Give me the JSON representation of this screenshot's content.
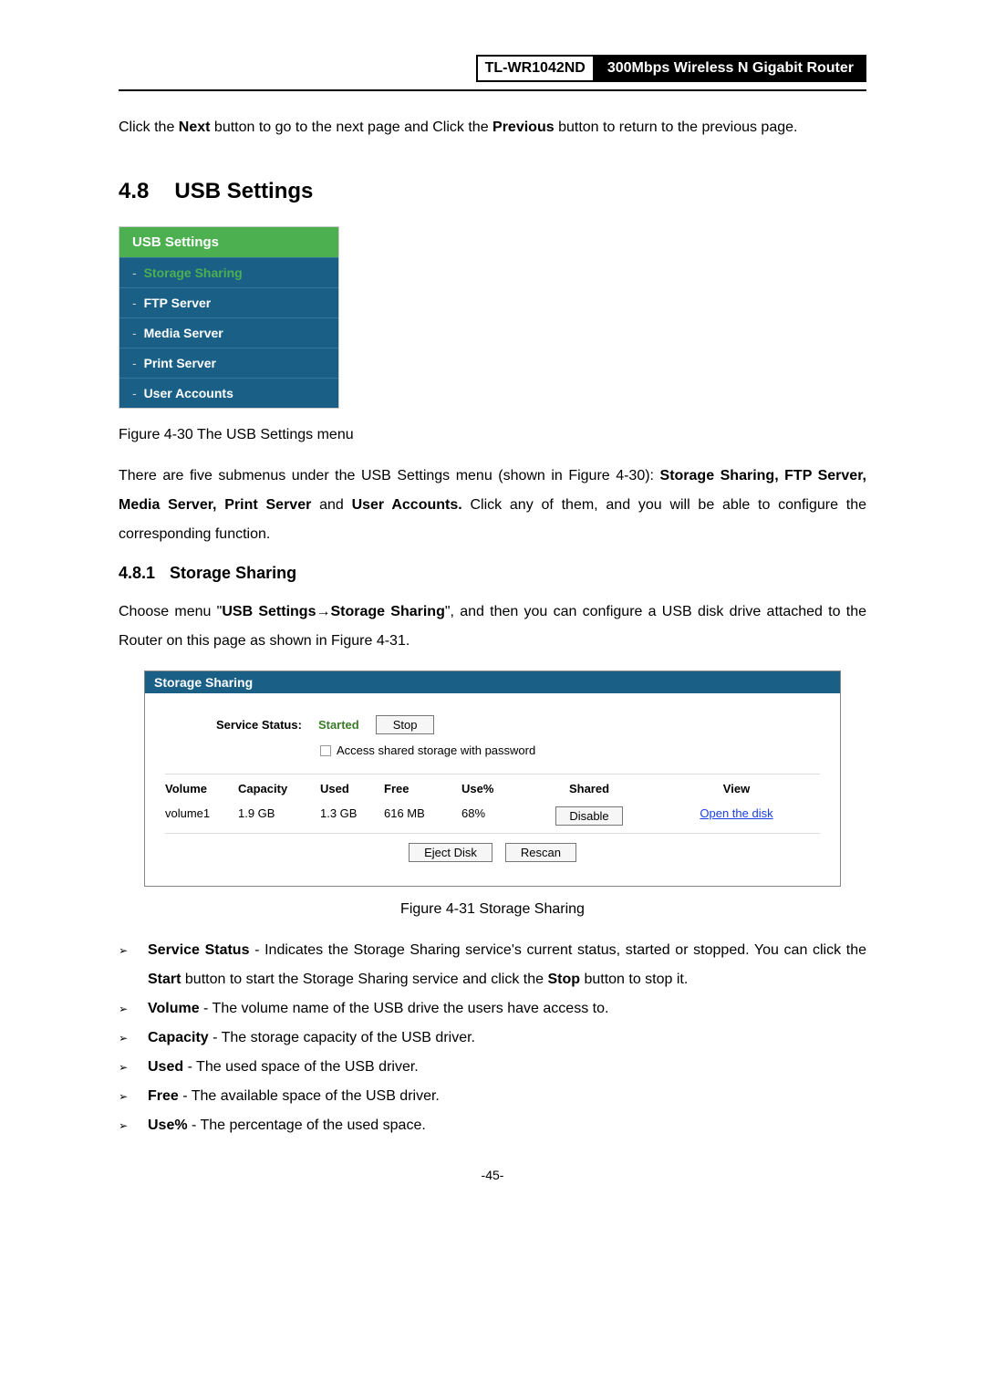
{
  "header": {
    "model": "TL-WR1042ND",
    "product": "300Mbps Wireless N Gigabit Router"
  },
  "intro": {
    "pre": "Click the ",
    "b1": "Next",
    "mid": " button to go to the next page and Click the ",
    "b2": "Previous",
    "post": " button to return to the previous page."
  },
  "section": {
    "num": "4.8",
    "title": "USB Settings"
  },
  "menu": {
    "header": "USB Settings",
    "items": [
      {
        "label": "Storage Sharing",
        "active": true
      },
      {
        "label": "FTP Server",
        "active": false
      },
      {
        "label": "Media Server",
        "active": false
      },
      {
        "label": "Print Server",
        "active": false
      },
      {
        "label": "User Accounts",
        "active": false
      }
    ]
  },
  "fig430": "Figure 4-30 The USB Settings menu",
  "para1": {
    "pre": "There are five submenus under the USB Settings menu (shown in Figure 4-30): ",
    "bold": "Storage Sharing, FTP Server, Media Server, Print Server",
    "mid": " and ",
    "bold2": "User Accounts.",
    "post": " Click any of them, and you will be able to configure the corresponding function."
  },
  "subsection": {
    "num": "4.8.1",
    "title": "Storage Sharing"
  },
  "para2": {
    "pre": "Choose menu \"",
    "b1": "USB Settings",
    "arrow": "→",
    "b2": "Storage Sharing",
    "post": "\", and then you can configure a USB disk drive attached to the Router on this page as shown in Figure 4-31."
  },
  "panel": {
    "title": "Storage Sharing",
    "service_status_label": "Service Status:",
    "service_status_val": "Started",
    "stop_btn": "Stop",
    "checkbox_label": "Access shared storage with password",
    "headers": {
      "vol": "Volume",
      "cap": "Capacity",
      "used": "Used",
      "free": "Free",
      "usep": "Use%",
      "shared": "Shared",
      "view": "View"
    },
    "row": {
      "vol": "volume1",
      "cap": "1.9 GB",
      "used": "1.3 GB",
      "free": "616 MB",
      "usep": "68%",
      "shared_btn": "Disable",
      "view_link": "Open the disk"
    },
    "eject": "Eject Disk",
    "rescan": "Rescan"
  },
  "fig431": "Figure 4-31 Storage Sharing",
  "bullets": [
    {
      "b": "Service Status",
      "t": " - Indicates the Storage Sharing service's current status, started or stopped. You can click the ",
      "b2": "Start",
      "t2": " button to start the Storage Sharing service and click the ",
      "b3": "Stop",
      "t3": " button to stop it."
    },
    {
      "b": "Volume",
      "t": " - The volume name of the USB drive the users have access to."
    },
    {
      "b": "Capacity",
      "t": " - The storage capacity of the USB driver."
    },
    {
      "b": "Used",
      "t": " - The used space of the USB driver."
    },
    {
      "b": "Free",
      "t": " - The available space of the USB driver."
    },
    {
      "b": "Use%",
      "t": " - The percentage of the used space."
    }
  ],
  "page_num": "-45-"
}
